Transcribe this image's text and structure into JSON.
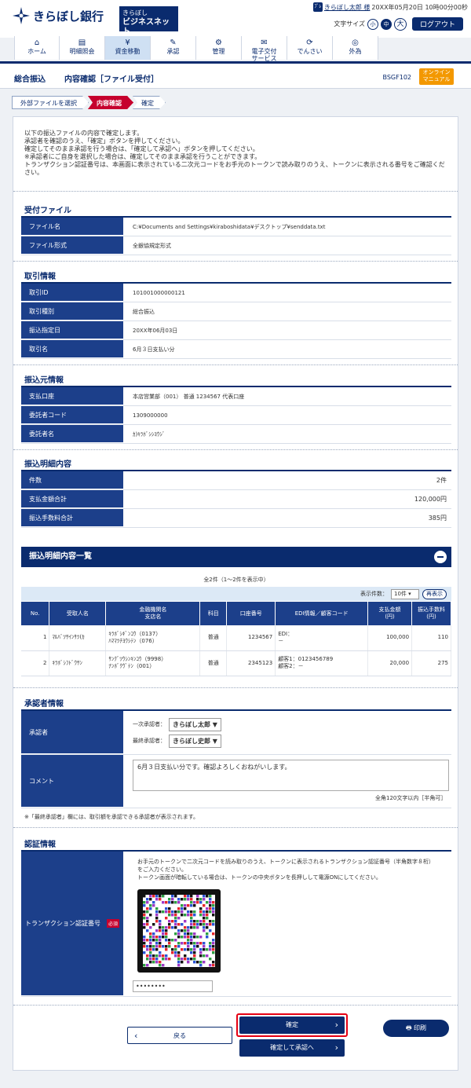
{
  "header": {
    "bank_name": "きらぼし銀行",
    "service_line1": "きらぼし",
    "service_line2": "ビジネスネット",
    "user_icon": "ﾌﾟﾚ",
    "user_name": "きらぼし太郎 様",
    "datetime": "20XX年05月20日 10時00分00秒",
    "font_size_label": "文字サイズ",
    "font_small": "小",
    "font_medium": "中",
    "font_large": "大",
    "logout": "ログアウト"
  },
  "gnav": [
    {
      "label1": "ホーム",
      "label2": "",
      "icon": "home-icon",
      "glyph": "⌂"
    },
    {
      "label1": "明細照会",
      "label2": "",
      "icon": "document-icon",
      "glyph": "▤"
    },
    {
      "label1": "資金移動",
      "label2": "",
      "icon": "yen-icon",
      "glyph": "¥"
    },
    {
      "label1": "承認",
      "label2": "",
      "icon": "approve-icon",
      "glyph": "✎"
    },
    {
      "label1": "管理",
      "label2": "",
      "icon": "management-icon",
      "glyph": "⚙"
    },
    {
      "label1": "電子交付",
      "label2": "サービス",
      "icon": "mail-icon",
      "glyph": "✉"
    },
    {
      "label1": "でんさい",
      "label2": "",
      "icon": "densai-icon",
      "glyph": "⟳"
    },
    {
      "label1": "外為",
      "label2": "",
      "icon": "globe-icon",
      "glyph": "◎"
    }
  ],
  "title": {
    "category": "総合振込",
    "page_title": "内容確認［ファイル受付］",
    "screen_id": "BSGF102",
    "manual_line1": "オンライン",
    "manual_line2": "マニュアル"
  },
  "steps": [
    "外部ファイルを選択",
    "内容確認",
    "確定"
  ],
  "intro": [
    "以下の振込ファイルの内容で確定します。",
    "承認者を確認のうえ、「確定」ボタンを押してください。",
    "確定してそのまま承認を行う場合は、「確定して承認へ」ボタンを押してください。",
    "※承認者にご自身を選択した場合は、確定してそのまま承認を行うことができます。",
    "トランザクション認証番号は、本画面に表示されている二次元コードをお手元のトークンで読み取りのうえ、トークンに表示される番号をご確認くだ",
    "さい。"
  ],
  "file_section": {
    "title": "受付ファイル",
    "rows": [
      {
        "label": "ファイル名",
        "value": "C:¥Documents and Settings¥kiraboshidata¥デスクトップ¥senddata.txt"
      },
      {
        "label": "ファイル形式",
        "value": "全銀協規定形式"
      }
    ]
  },
  "transaction_section": {
    "title": "取引情報",
    "rows": [
      {
        "label": "取引ID",
        "value": "101001000000121"
      },
      {
        "label": "取引種別",
        "value": "総合振込"
      },
      {
        "label": "振込指定日",
        "value": "20XX年06月03日"
      },
      {
        "label": "取引名",
        "value": "6月３日支払い分"
      }
    ]
  },
  "source_section": {
    "title": "振込元情報",
    "rows": [
      {
        "label": "支払口座",
        "value": "本店営業部（001） 普通 1234567 代表口座"
      },
      {
        "label": "委託者コード",
        "value": "1309000000"
      },
      {
        "label": "委託者名",
        "value": "ｶ)ｷﾗﾎﾞｼｼﾖｳｼﾞ"
      }
    ]
  },
  "detail_section": {
    "title": "振込明細内容",
    "rows": [
      {
        "label": "件数",
        "value": "2件"
      },
      {
        "label": "支払金額合計",
        "value": "120,000円"
      },
      {
        "label": "振込手数料合計",
        "value": "385円"
      }
    ]
  },
  "list_section": {
    "title": "振込明細内容一覧",
    "count_text": "全2件（1～2件を表示中）",
    "display_label": "表示件数：",
    "display_value": "10件",
    "redisplay": "再表示",
    "headers": [
      {
        "l1": "No.",
        "l2": ""
      },
      {
        "l1": "受取人名",
        "l2": ""
      },
      {
        "l1": "金融機関名",
        "l2": "支店名"
      },
      {
        "l1": "科目",
        "l2": ""
      },
      {
        "l1": "口座番号",
        "l2": ""
      },
      {
        "l1": "EDI情報／顧客コード",
        "l2": ""
      },
      {
        "l1": "支払金額",
        "l2": "(円)"
      },
      {
        "l1": "振込手数料",
        "l2": "(円)"
      }
    ],
    "rows": [
      {
        "no": "1",
        "payee": "ﾏﾙﾊﾞﾂｻｲﾝｻﾂ(ｶ",
        "bank": "ｷﾗﾎﾞｼｷﾞﾝｺｳ（0137）",
        "branch": "ﾊﾏﾏﾂﾁﾖｳｼﾃﾝ（076）",
        "type": "普通",
        "account": "1234567",
        "info1": "EDI：",
        "info2": "－",
        "amount": "100,000",
        "fee": "110"
      },
      {
        "no": "2",
        "payee": "ｷﾗﾎﾞｼﾌﾄﾞｳｻﾝ",
        "bank": "ｻﾝｸﾞﾂｳｼﾝｷﾝｺｳ（9998）",
        "branch": "ﾅﾝﾎﾞｸｳﾞﾃﾝ（001）",
        "type": "普通",
        "account": "2345123",
        "info1": "顧客1：0123456789",
        "info2": "顧客2：－",
        "amount": "20,000",
        "fee": "275"
      }
    ]
  },
  "approver_section": {
    "title": "承認者情報",
    "approver_label": "承認者",
    "first_label": "一次承認者：",
    "first_value": "きらぼし太郎",
    "final_label": "最終承認者：",
    "final_value": "きらぼし史郎",
    "comment_label": "コメント",
    "comment_value": "6月３日支払い分です。確認よろしくおねがいします。",
    "comment_limit": "全角120文字以内［半角可］",
    "note": "※「最終承認者」欄には、取引額を承認できる承認者が表示されます。"
  },
  "auth_section": {
    "title": "認証情報",
    "label": "トランザクション認証番号",
    "required": "必須",
    "desc1": "お手元のトークンで二次元コードを読み取りのうえ、トークンに表示されるトランザクション認証番号（半角数字８桁）",
    "desc2": "をご入力ください。",
    "desc3": "トークン画面が暗転している場合は、トークンの中央ボタンを長押しして電源ONにしてください。",
    "password": "••••••••"
  },
  "buttons": {
    "back": "戻る",
    "confirm": "確定",
    "confirm_approve": "確定して承認へ",
    "print": "印刷"
  },
  "colors": {
    "navy": "#0a2b6e",
    "accent_red": "#c6002d",
    "manual_orange": "#f39800",
    "highlight": "#e60012"
  }
}
